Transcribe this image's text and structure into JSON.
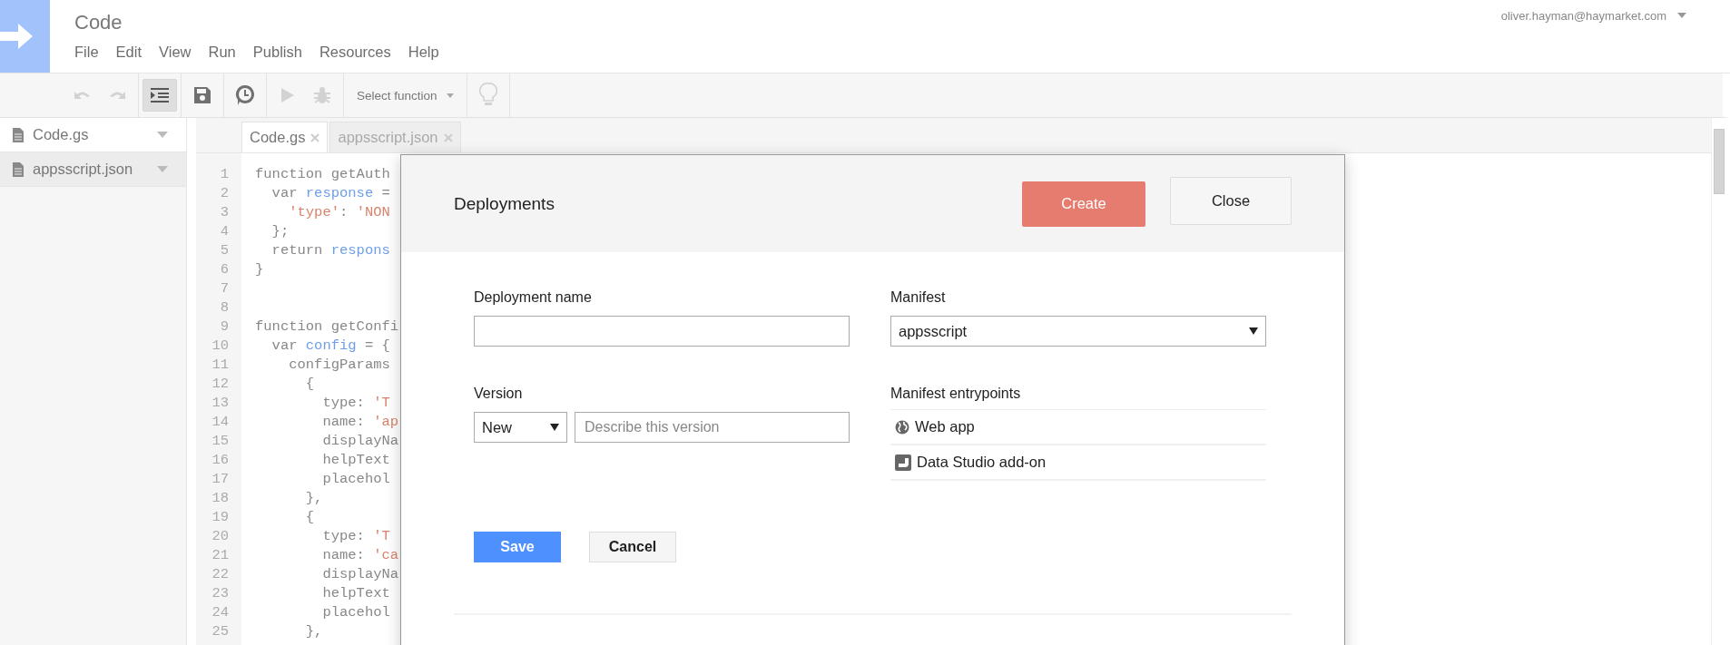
{
  "header": {
    "title": "Code",
    "menu": [
      "File",
      "Edit",
      "View",
      "Run",
      "Publish",
      "Resources",
      "Help"
    ],
    "account": "oliver.hayman@haymarket.com"
  },
  "toolbar": [
    {
      "kind": "undo",
      "disabled": true
    },
    {
      "kind": "redo",
      "disabled": true
    },
    {
      "kind": "indent",
      "disabled": false,
      "pressed": true
    },
    {
      "kind": "save",
      "disabled": false
    },
    {
      "kind": "triggers",
      "disabled": false
    },
    {
      "kind": "run",
      "disabled": true
    },
    {
      "kind": "debug",
      "disabled": true
    },
    {
      "kind": "function_select",
      "label": "Select function",
      "disabled": false
    },
    {
      "kind": "bulb",
      "disabled": true
    }
  ],
  "sidebar": {
    "files": [
      {
        "name": "Code.gs",
        "selected": true
      },
      {
        "name": "appsscript.json",
        "selected": false
      }
    ]
  },
  "editor": {
    "tabs": [
      {
        "label": "Code.gs",
        "selected": true
      },
      {
        "label": "appsscript.json",
        "selected": false
      }
    ],
    "lines": [
      {
        "number": "1",
        "segments": [
          {
            "kind": "plain",
            "text": "function getAuth"
          }
        ]
      },
      {
        "number": "2",
        "segments": [
          {
            "kind": "plain",
            "text": "  var "
          },
          {
            "kind": "var",
            "text": "response"
          },
          {
            "kind": "plain",
            "text": " ="
          }
        ]
      },
      {
        "number": "3",
        "segments": [
          {
            "kind": "str",
            "text": "    'type'"
          },
          {
            "kind": "plain",
            "text": ": "
          },
          {
            "kind": "str",
            "text": "'NON"
          }
        ]
      },
      {
        "number": "4",
        "segments": [
          {
            "kind": "plain",
            "text": "  };"
          }
        ]
      },
      {
        "number": "5",
        "segments": [
          {
            "kind": "plain",
            "text": "  return "
          },
          {
            "kind": "var",
            "text": "respons"
          }
        ]
      },
      {
        "number": "6",
        "segments": [
          {
            "kind": "plain",
            "text": "}"
          }
        ]
      },
      {
        "number": "7"
      },
      {
        "number": "8"
      },
      {
        "number": "9",
        "segments": [
          {
            "kind": "plain",
            "text": "function getConfi"
          }
        ]
      },
      {
        "number": "10",
        "segments": [
          {
            "kind": "plain",
            "text": "  var "
          },
          {
            "kind": "var",
            "text": "config"
          },
          {
            "kind": "plain",
            "text": " = {"
          }
        ]
      },
      {
        "number": "11",
        "segments": [
          {
            "kind": "plain",
            "text": "    configParams"
          }
        ]
      },
      {
        "number": "12",
        "segments": [
          {
            "kind": "plain",
            "text": "      {"
          }
        ]
      },
      {
        "number": "13",
        "segments": [
          {
            "kind": "plain",
            "text": "        type: "
          },
          {
            "kind": "str",
            "text": "'T"
          }
        ]
      },
      {
        "number": "14",
        "segments": [
          {
            "kind": "plain",
            "text": "        name: "
          },
          {
            "kind": "str",
            "text": "'ap"
          }
        ]
      },
      {
        "number": "15",
        "segments": [
          {
            "kind": "plain",
            "text": "        displayNa"
          }
        ]
      },
      {
        "number": "16",
        "segments": [
          {
            "kind": "plain",
            "text": "        helpText"
          }
        ]
      },
      {
        "number": "17",
        "segments": [
          {
            "kind": "plain",
            "text": "        placehol"
          }
        ]
      },
      {
        "number": "18",
        "segments": [
          {
            "kind": "plain",
            "text": "      },"
          }
        ]
      },
      {
        "number": "19",
        "segments": [
          {
            "kind": "plain",
            "text": "      {"
          }
        ]
      },
      {
        "number": "20",
        "segments": [
          {
            "kind": "plain",
            "text": "        type: "
          },
          {
            "kind": "str",
            "text": "'T"
          }
        ]
      },
      {
        "number": "21",
        "segments": [
          {
            "kind": "plain",
            "text": "        name: "
          },
          {
            "kind": "str",
            "text": "'ca"
          }
        ]
      },
      {
        "number": "22",
        "segments": [
          {
            "kind": "plain",
            "text": "        displayNa"
          }
        ]
      },
      {
        "number": "23",
        "segments": [
          {
            "kind": "plain",
            "text": "        helpText"
          }
        ]
      },
      {
        "number": "24",
        "segments": [
          {
            "kind": "plain",
            "text": "        placehol"
          }
        ]
      },
      {
        "number": "25",
        "segments": [
          {
            "kind": "plain",
            "text": "      },"
          }
        ]
      }
    ]
  },
  "dialog": {
    "title": "Deployments",
    "create_button": "Create",
    "close_button": "Close",
    "deployment_name": {
      "label": "Deployment name"
    },
    "manifest": {
      "label": "Manifest",
      "value": "appsscript"
    },
    "version": {
      "label": "Version",
      "value": "New",
      "description_placeholder": "Describe this version"
    },
    "entrypoints": {
      "label": "Manifest entrypoints",
      "items": [
        {
          "kind": "web_app",
          "label": "Web app"
        },
        {
          "kind": "data_studio",
          "label": "Data Studio add-on"
        }
      ]
    },
    "save_button": "Save",
    "cancel_button": "Cancel"
  }
}
